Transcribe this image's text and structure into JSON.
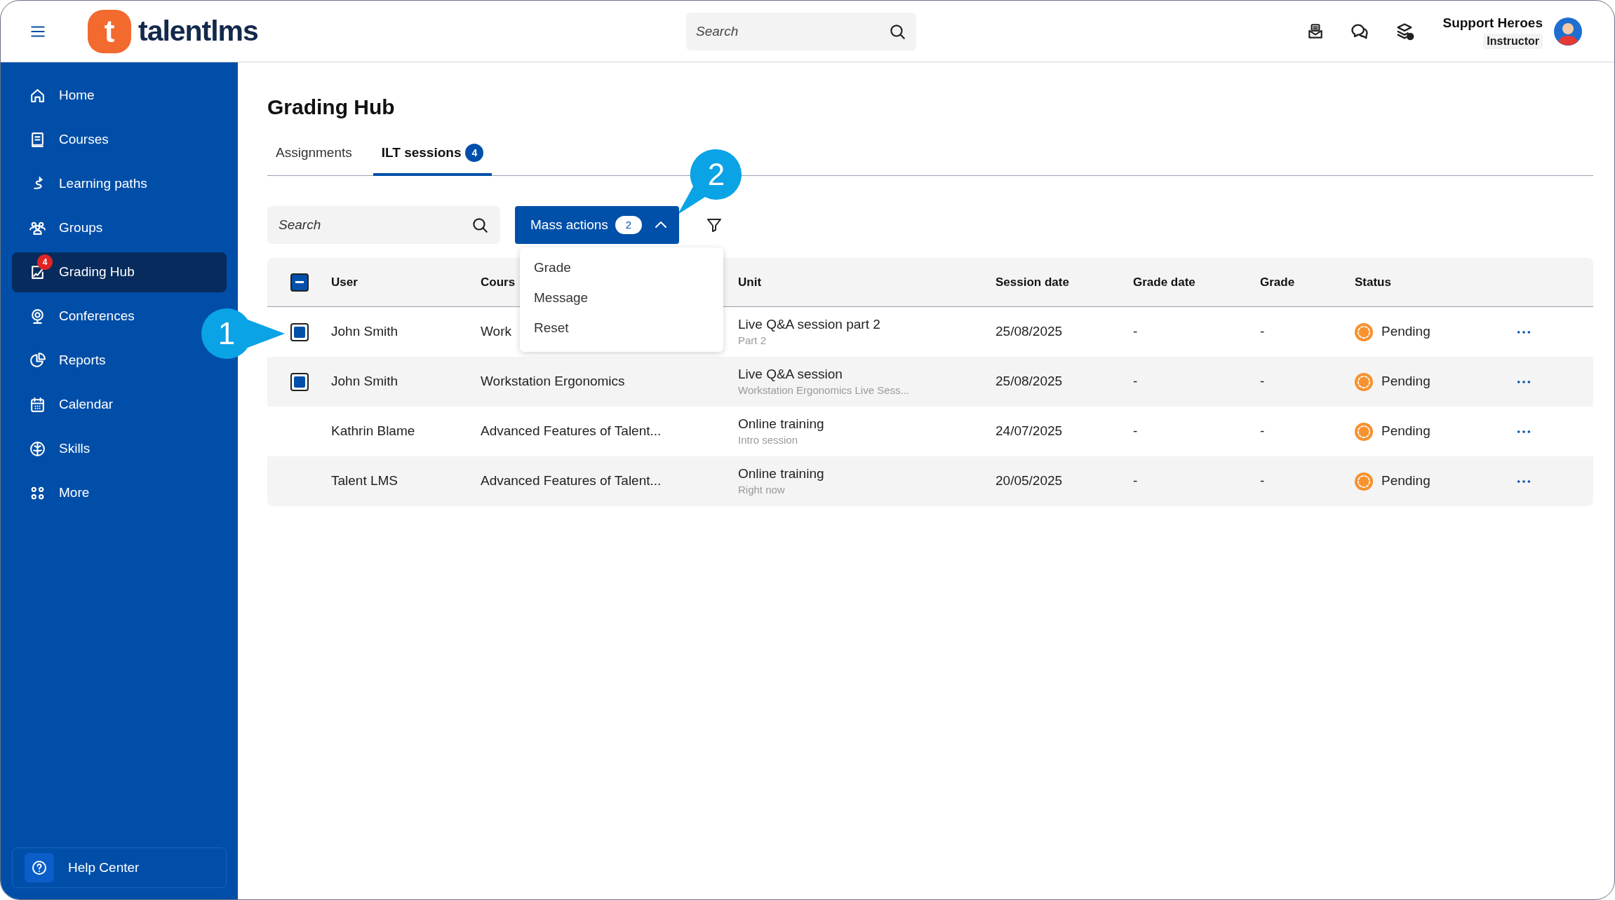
{
  "header": {
    "logo_mark": "t",
    "logo_text": "talentlms",
    "search": {
      "placeholder": "Search"
    },
    "user": {
      "name": "Support Heroes",
      "role": "Instructor"
    }
  },
  "sidebar": {
    "items": [
      {
        "label": "Home",
        "selected": false
      },
      {
        "label": "Courses",
        "selected": false
      },
      {
        "label": "Learning paths",
        "selected": false
      },
      {
        "label": "Groups",
        "selected": false
      },
      {
        "label": "Grading Hub",
        "selected": true,
        "badge": "4"
      },
      {
        "label": "Conferences",
        "selected": false
      },
      {
        "label": "Reports",
        "selected": false
      },
      {
        "label": "Calendar",
        "selected": false
      },
      {
        "label": "Skills",
        "selected": false
      },
      {
        "label": "More",
        "selected": false
      }
    ],
    "help": {
      "label": "Help Center"
    }
  },
  "page": {
    "title": "Grading Hub",
    "tabs": [
      {
        "label": "Assignments",
        "selected": false
      },
      {
        "label": "ILT sessions",
        "badge": "4",
        "selected": true
      }
    ],
    "toolbar": {
      "search": {
        "placeholder": "Search"
      },
      "mass_actions": {
        "label": "Mass actions",
        "count": "2",
        "expanded": true,
        "menu": [
          "Grade",
          "Message",
          "Reset"
        ]
      }
    },
    "table": {
      "select_all_partial": true,
      "columns": [
        "User",
        "Cours",
        "Unit",
        "Session date",
        "Grade date",
        "Grade",
        "Status"
      ],
      "rows": [
        {
          "selected": true,
          "user": "John Smith",
          "course": "Work",
          "unit": "Live Q&A session part 2",
          "unit_detail": "Part 2",
          "session_date": "25/08/2025",
          "grade_date": "-",
          "grade": "-",
          "status": "Pending"
        },
        {
          "selected": true,
          "user": "John Smith",
          "course": "Workstation Ergonomics",
          "unit": "Live Q&A session",
          "unit_detail": "Workstation Ergonomics Live Sess...",
          "session_date": "25/08/2025",
          "grade_date": "-",
          "grade": "-",
          "status": "Pending"
        },
        {
          "selected": false,
          "user": "Kathrin Blame",
          "course": "Advanced Features of Talent...",
          "unit": "Online training",
          "unit_detail": "Intro session",
          "session_date": "24/07/2025",
          "grade_date": "-",
          "grade": "-",
          "status": "Pending"
        },
        {
          "selected": false,
          "user": "Talent LMS",
          "course": "Advanced Features of Talent...",
          "unit": "Online training",
          "unit_detail": "Right now",
          "session_date": "20/05/2025",
          "grade_date": "-",
          "grade": "-",
          "status": "Pending"
        }
      ]
    }
  },
  "callouts": [
    {
      "number": "1"
    },
    {
      "number": "2"
    }
  ]
}
